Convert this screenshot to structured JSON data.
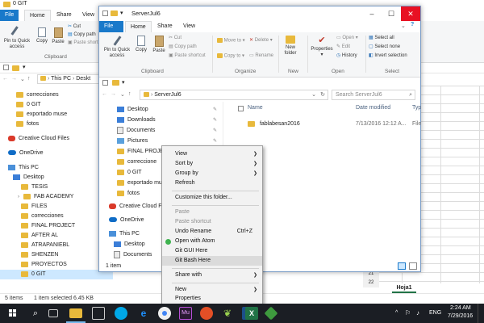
{
  "bg": {
    "title": "0 GIT",
    "tabs": [
      "File",
      "Home",
      "Share",
      "View"
    ],
    "ribbon": {
      "pin": "Pin to Quick access",
      "copy": "Copy",
      "paste": "Paste",
      "cut": "Cut",
      "copy_path": "Copy path",
      "paste_shortcut": "Paste short",
      "group": "Clipboard"
    },
    "addr": [
      "This PC",
      "Deskt"
    ],
    "nav": [
      "correcciones",
      "0 GIT",
      "exportado muse",
      "fotos",
      "Creative Cloud Files",
      "OneDrive",
      "This PC",
      "Desktop",
      "TESIS",
      "FAB ACADEMY",
      "FILES",
      "correcciones",
      "FINAL PROJECT",
      "AFTER AL",
      "ATRAPANIEBL",
      "SHENZEN",
      "PROYECTOS",
      "0 GIT"
    ],
    "status_items": "5 items",
    "status_selected": "1 item selected  6.45 KB"
  },
  "excel": {
    "rows": [
      "21",
      "22"
    ],
    "sheet": "Hoja1"
  },
  "fg": {
    "title": "ServerJul6",
    "tabs": [
      "File",
      "Home",
      "Share",
      "View"
    ],
    "ribbon": {
      "pin": "Pin to Quick access",
      "copy": "Copy",
      "paste": "Paste",
      "cut": "Cut",
      "copy_path": "Copy path",
      "paste_shortcut": "Paste shortcut",
      "clipboard": "Clipboard",
      "move_to": "Move to",
      "copy_to": "Copy to",
      "delete": "Delete",
      "rename": "Rename",
      "organize": "Organize",
      "new_folder": "New folder",
      "new": "New",
      "properties": "Properties",
      "open": "Open",
      "edit": "Edit",
      "history": "History",
      "open_grp": "Open",
      "select_all": "Select all",
      "select_none": "Select none",
      "invert": "Invert selection",
      "select": "Select"
    },
    "path": "ServerJul6",
    "search_placeholder": "Search ServerJul6",
    "nav": [
      "Desktop",
      "Downloads",
      "Documents",
      "Pictures",
      "FINAL PROJECT",
      "correccione",
      "0 GIT",
      "exportado muse",
      "fotos",
      "Creative Cloud File",
      "OneDrive",
      "This PC",
      "Desktop",
      "Documents"
    ],
    "col_name": "Name",
    "col_date": "Date modified",
    "col_type": "Typ",
    "file_name": "fablabesan2016",
    "file_date": "7/13/2016 12:12 A...",
    "file_type": "File",
    "status": "1 item"
  },
  "menu": {
    "view": "View",
    "sort_by": "Sort by",
    "group_by": "Group by",
    "refresh": "Refresh",
    "customize": "Customize this folder...",
    "paste": "Paste",
    "paste_shortcut": "Paste shortcut",
    "undo": "Undo Rename",
    "undo_key": "Ctrl+Z",
    "atom": "Open with Atom",
    "git_gui": "Git GUI Here",
    "git_bash": "Git Bash Here",
    "share": "Share with",
    "new": "New",
    "properties": "Properties"
  },
  "taskbar": {
    "lang": "ENG",
    "time": "2:24 AM",
    "date": "7/29/2016"
  }
}
